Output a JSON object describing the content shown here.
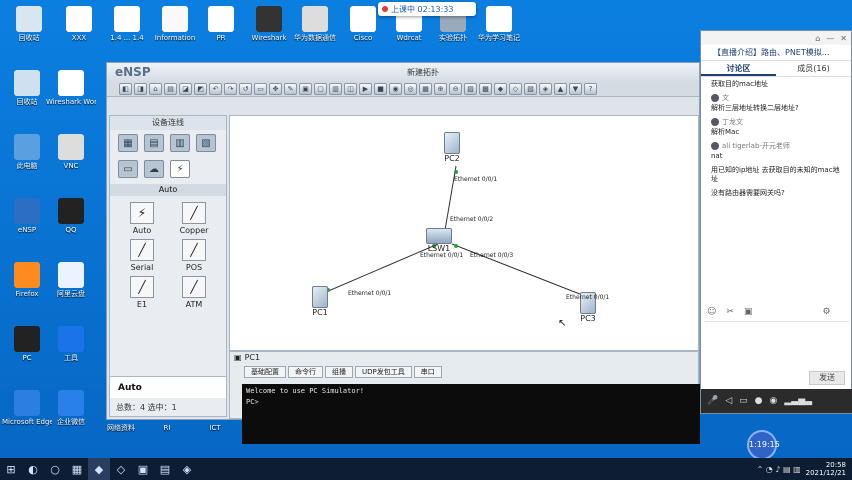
{
  "recording": {
    "label": "上课中 02:13:33"
  },
  "desktop_icons": [
    {
      "label": "回收站",
      "glyph": "recycle-bin-icon"
    },
    {
      "label": "XXX",
      "glyph": "star-icon"
    },
    {
      "label": "1.4 ... 1.4",
      "glyph": "doc-icon"
    },
    {
      "label": "Information",
      "glyph": "doc-icon"
    },
    {
      "label": "PR",
      "glyph": "doc-icon"
    },
    {
      "label": "Wireshark",
      "glyph": "doc-icon"
    },
    {
      "label": "华为数据通信",
      "glyph": "doc-icon"
    },
    {
      "label": "Cisco",
      "glyph": "doc-icon"
    },
    {
      "label": "Wdrcat",
      "glyph": "doc-icon"
    },
    {
      "label": "实验拓扑",
      "glyph": "doc-icon"
    },
    {
      "label": "华为学习笔记",
      "glyph": "doc-icon"
    }
  ],
  "left_icons": [
    {
      "label": "回收站"
    },
    {
      "label": "Wireshark Workstation"
    },
    {
      "label": "此电脑"
    },
    {
      "label": "VNC"
    },
    {
      "label": "eNSP"
    },
    {
      "label": "QQ"
    },
    {
      "label": "Firefox"
    },
    {
      "label": "阿里云盘"
    },
    {
      "label": "PC"
    },
    {
      "label": "工具"
    },
    {
      "label": "Microsoft Edge"
    },
    {
      "label": "企业微信"
    }
  ],
  "bottom_icons": [
    {
      "label": "网络资料"
    },
    {
      "label": "RI"
    },
    {
      "label": "ICT"
    }
  ],
  "ensp": {
    "logo": "eNSP",
    "window_title": "新建拓扑",
    "left_panel_head": "设备连线",
    "auto_label": "Auto",
    "auto_bar": "Auto",
    "cables": [
      {
        "label": "Auto",
        "glyph": "⚡"
      },
      {
        "label": "Copper",
        "glyph": "╱"
      },
      {
        "label": "Serial",
        "glyph": "╱"
      },
      {
        "label": "POS",
        "glyph": "╱"
      },
      {
        "label": "E1",
        "glyph": "╱"
      },
      {
        "label": "ATM",
        "glyph": "╱"
      }
    ],
    "status": "总数：4  选中：1",
    "nodes": {
      "pc2": "PC2",
      "lsw1": "LSW1",
      "pc1": "PC1",
      "pc3": "PC3"
    },
    "ports": {
      "pc2_port": "Ethernet 0/0/1",
      "lsw_up": "Ethernet 0/0/2",
      "lsw_left": "Ethernet 0/0/1",
      "lsw_right": "Ethernet 0/0/3",
      "pc1_port": "Ethernet 0/0/1",
      "pc3_port": "Ethernet 0/0/1"
    },
    "pc_window": {
      "title": "PC1",
      "tabs": [
        "基础配置",
        "命令行",
        "组播",
        "UDP发包工具",
        "串口"
      ],
      "terminal_lines": [
        "Welcome to use PC Simulator!",
        "",
        "PC>"
      ]
    }
  },
  "chat": {
    "title": "【直播介绍】路由、PNET模拟...",
    "tabs": [
      "讨论区",
      "成员(16)"
    ],
    "messages": [
      {
        "who": "",
        "text": "获取目的mac地址"
      },
      {
        "who": "文",
        "text": "解析三层地址转换二层地址?"
      },
      {
        "who": "丁龙文",
        "text": "解析Mac"
      },
      {
        "who": "ali tigerlab-开元老师",
        "text": "nat"
      },
      {
        "who": "",
        "text": "用已知的ip地址 去获取目的未知的mac地址"
      },
      {
        "who": "",
        "text": "没有路由器需要网关吗?"
      }
    ],
    "send_label": "发送",
    "timer": "1:19:15"
  },
  "taskbar": {
    "time": "20:58",
    "date": "2021/12/21"
  }
}
